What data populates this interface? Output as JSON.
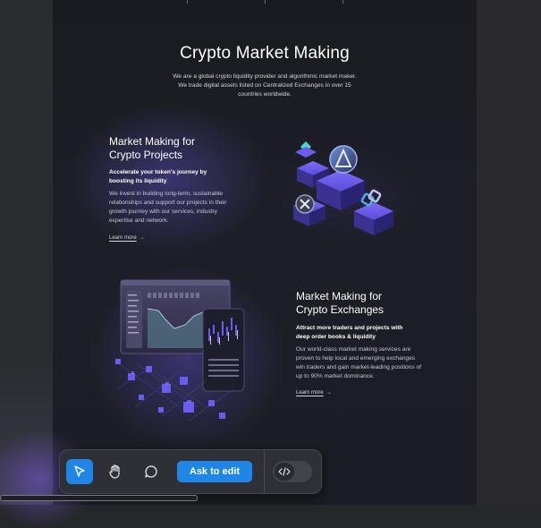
{
  "hero": {
    "title": "Crypto Market Making",
    "description": "We are a global crypto liquidity provider and algorithmic market maker. We trade digital assets listed on Centralized Exchanges in over 15 countries worldwide."
  },
  "section_projects": {
    "title_line1": "Market Making for",
    "title_line2": "Crypto Projects",
    "subtitle": "Accelerate your token's journey by boosting its liquidity",
    "body": "We invest in building long-term, sustainable relationships and support our projects in their growth journey with our services, industry expertise and network.",
    "link": "Learn more"
  },
  "section_exchanges": {
    "title_line1": "Market Making for",
    "title_line2": "Crypto Exchanges",
    "subtitle": "Attract more traders and projects with deep order books & liquidity",
    "body": "Our world-class market making services are proven to help local and emerging exchanges win traders and gain market-leading positions of up to 90% market dominance.",
    "link": "Learn more"
  },
  "toolbar": {
    "ask_label": "Ask to edit",
    "tools": [
      "cursor-icon",
      "hand-icon",
      "comment-icon"
    ],
    "code_icon": "code-icon",
    "accent": "#1f86e8"
  },
  "colors": {
    "page_bg": "#1a1b20",
    "accent_purple": "#6a5cf0"
  }
}
